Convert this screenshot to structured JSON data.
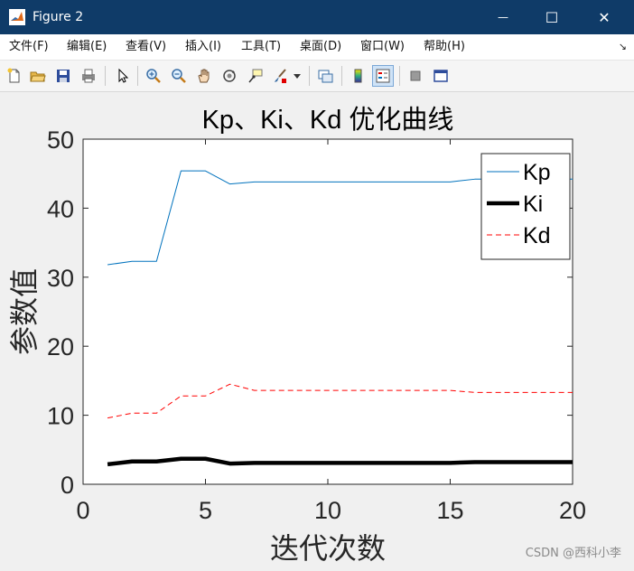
{
  "window": {
    "title": "Figure 2",
    "minimize_glyph": "—",
    "maximize_glyph": "☐",
    "close_glyph": "✕"
  },
  "menu": {
    "items": [
      "文件(F)",
      "编辑(E)",
      "查看(V)",
      "插入(I)",
      "工具(T)",
      "桌面(D)",
      "窗口(W)",
      "帮助(H)"
    ],
    "overflow_glyph": "↘"
  },
  "toolbar": {
    "icons": [
      "new-figure-icon",
      "open-file-icon",
      "save-icon",
      "print-icon",
      "pointer-icon",
      "zoom-in-icon",
      "zoom-out-icon",
      "pan-hand-icon",
      "rotate-3d-icon",
      "data-cursor-icon",
      "brush-icon",
      "link-plot-icon",
      "colorbar-icon",
      "legend-icon",
      "hide-tools-icon",
      "dock-icon"
    ]
  },
  "watermark": "CSDN @西科小李",
  "colors": {
    "kp": "#0072bd",
    "ki": "#000000",
    "kd": "#ff0000",
    "titlebar": "#0f3b68"
  },
  "chart_data": {
    "type": "line",
    "title": "Kp、Ki、Kd 优化曲线",
    "xlabel": "迭代次数",
    "ylabel": "参数值",
    "xlim": [
      0,
      20
    ],
    "ylim": [
      0,
      50
    ],
    "xticks": [
      0,
      5,
      10,
      15,
      20
    ],
    "yticks": [
      0,
      10,
      20,
      30,
      40,
      50
    ],
    "grid": false,
    "legend_position": "top-right",
    "x": [
      1,
      2,
      3,
      4,
      5,
      6,
      7,
      8,
      9,
      10,
      11,
      12,
      13,
      14,
      15,
      16,
      17,
      18,
      19,
      20
    ],
    "series": [
      {
        "name": "Kp",
        "style": "solid-thin",
        "values": [
          31.8,
          32.3,
          32.3,
          45.4,
          45.4,
          43.5,
          43.8,
          43.8,
          43.8,
          43.8,
          43.8,
          43.8,
          43.8,
          43.8,
          43.8,
          44.2,
          44.2,
          44.2,
          44.2,
          44.2
        ]
      },
      {
        "name": "Ki",
        "style": "solid-thick",
        "values": [
          2.9,
          3.3,
          3.3,
          3.7,
          3.7,
          3.0,
          3.1,
          3.1,
          3.1,
          3.1,
          3.1,
          3.1,
          3.1,
          3.1,
          3.1,
          3.2,
          3.2,
          3.2,
          3.2,
          3.2
        ]
      },
      {
        "name": "Kd",
        "style": "dashed",
        "values": [
          9.6,
          10.3,
          10.3,
          12.8,
          12.8,
          14.5,
          13.6,
          13.6,
          13.6,
          13.6,
          13.6,
          13.6,
          13.6,
          13.6,
          13.6,
          13.3,
          13.3,
          13.3,
          13.3,
          13.3
        ]
      }
    ]
  }
}
